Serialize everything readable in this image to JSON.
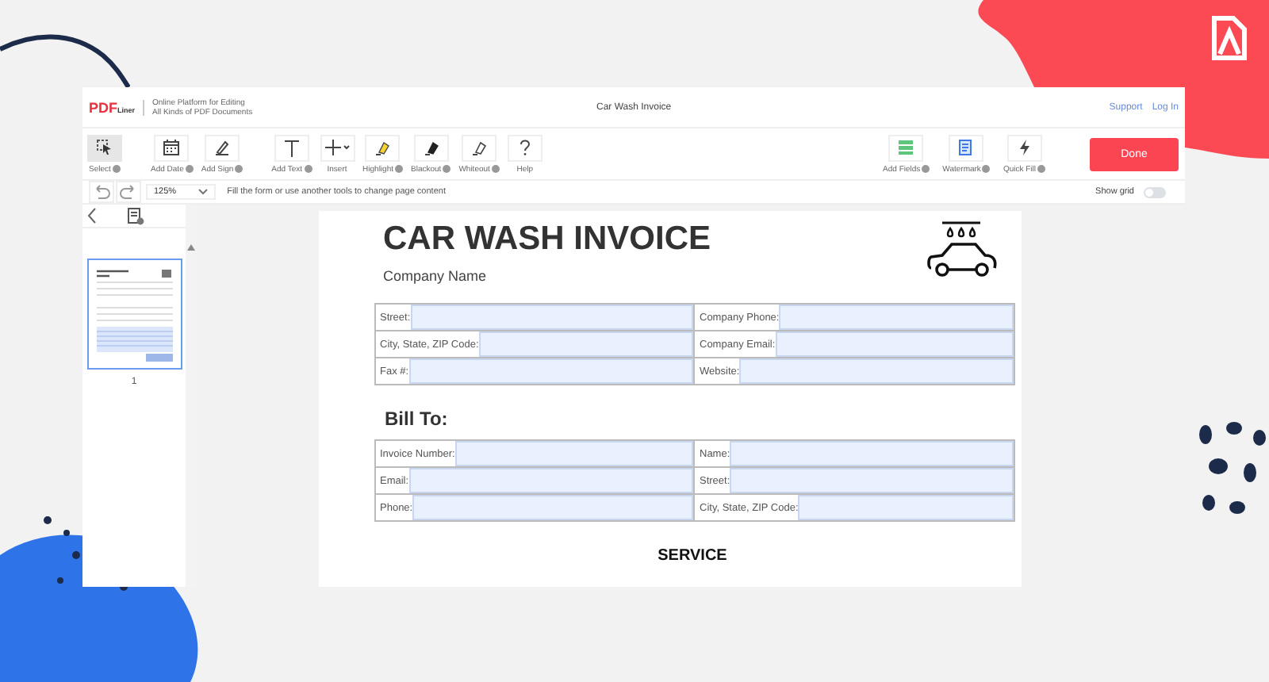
{
  "header": {
    "logo": {
      "mark": "PDF",
      "suffix": "Liner"
    },
    "tagline": [
      "Online Platform for Editing",
      "All Kinds of PDF Documents"
    ],
    "title": "Car Wash Invoice",
    "links": [
      "Support",
      "Log In"
    ]
  },
  "toolbar": {
    "groups": [
      [
        {
          "kind": "select",
          "label": "Select",
          "info": true,
          "selected": true
        }
      ],
      [
        {
          "kind": "date",
          "label": "Add Date",
          "info": true,
          "selected": false
        },
        {
          "kind": "sign",
          "label": "Add Sign",
          "info": true,
          "selected": false
        }
      ],
      [
        {
          "kind": "text",
          "label": "Add Text",
          "info": true,
          "selected": false
        },
        {
          "kind": "insert",
          "label": "Insert",
          "info": false,
          "selected": false
        },
        {
          "kind": "highlight",
          "label": "Highlight",
          "info": true,
          "selected": false
        },
        {
          "kind": "blackout",
          "label": "Blackout",
          "info": true,
          "selected": false
        },
        {
          "kind": "whiteout",
          "label": "Whiteout",
          "info": true,
          "selected": false
        },
        {
          "kind": "help",
          "label": "Help",
          "info": false,
          "selected": false
        }
      ]
    ],
    "right_tools": [
      {
        "kind": "fields",
        "label": "Add Fields",
        "info": true,
        "selected": false
      },
      {
        "kind": "watermark",
        "label": "Watermark",
        "info": true,
        "selected": false
      },
      {
        "kind": "quickfill",
        "label": "Quick Fill",
        "info": true,
        "selected": false
      }
    ],
    "done_button": "Done"
  },
  "subbar": {
    "zoom": "125%",
    "hint": "Fill the form or use another tools to change page content",
    "show_grid": {
      "label": "Show grid",
      "on": false
    }
  },
  "sidebar": {
    "pages": [
      {
        "number": "1",
        "selected": true
      }
    ]
  },
  "document": {
    "title": "CAR WASH INVOICE",
    "company_name": "Company Name",
    "company_table": [
      [
        "Street:",
        "Company Phone:"
      ],
      [
        "City, State, ZIP Code:",
        "Company Email:"
      ],
      [
        "Fax #:",
        "Website:"
      ]
    ],
    "bill_to": "Bill To:",
    "bill_table": [
      [
        "Invoice Number:",
        "Name:"
      ],
      [
        "Email:",
        "Street:"
      ],
      [
        "Phone:",
        "City, State, ZIP Code:"
      ]
    ],
    "service": "SERVICE"
  }
}
